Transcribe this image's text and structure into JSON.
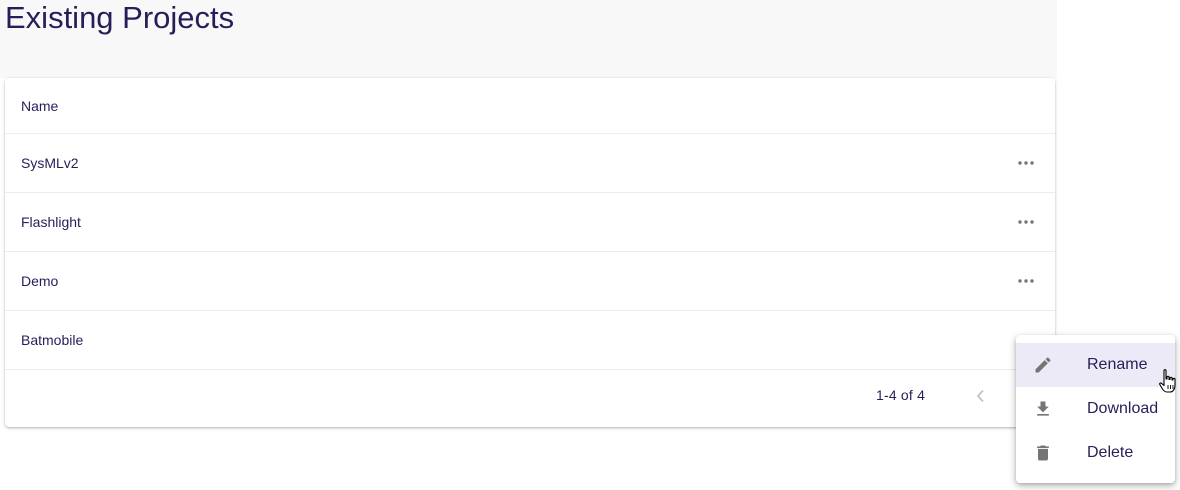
{
  "header": {
    "title": "Existing Projects"
  },
  "table": {
    "column_header": "Name",
    "rows": [
      {
        "name": "SysMLv2",
        "has_actions": true
      },
      {
        "name": "Flashlight",
        "has_actions": true
      },
      {
        "name": "Demo",
        "has_actions": true
      },
      {
        "name": "Batmobile",
        "has_actions": true
      }
    ],
    "pagination": {
      "range_text": "1-4 of 4"
    }
  },
  "context_menu": {
    "items": [
      {
        "label": "Rename",
        "icon": "pencil-icon",
        "selected": true
      },
      {
        "label": "Download",
        "icon": "download-icon",
        "selected": false
      },
      {
        "label": "Delete",
        "icon": "trash-icon",
        "selected": false
      }
    ]
  },
  "colors": {
    "text": "#261e58",
    "header_bg": "#f8f8f8",
    "icon": "#757575",
    "selected_bg": "#ebeaf6"
  }
}
